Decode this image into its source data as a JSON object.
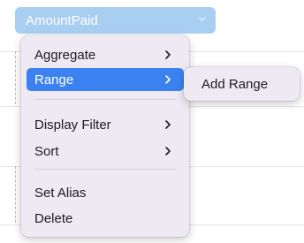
{
  "field_pill": {
    "label": "AmountPaid"
  },
  "context_menu": {
    "items": [
      {
        "label": "Aggregate"
      },
      {
        "label": "Range"
      },
      {
        "label": "Display Filter"
      },
      {
        "label": "Sort"
      },
      {
        "label": "Set Alias"
      },
      {
        "label": "Delete"
      }
    ]
  },
  "submenu": {
    "items": [
      {
        "label": "Add Range"
      }
    ]
  },
  "colors": {
    "pill": "#a8cff1",
    "menu_bg": "#efe9f4",
    "highlight": "#3b82f0"
  },
  "icons": {
    "pill_dropdown": "chevron-down-icon",
    "submenu_arrow": "chevron-right-icon"
  }
}
